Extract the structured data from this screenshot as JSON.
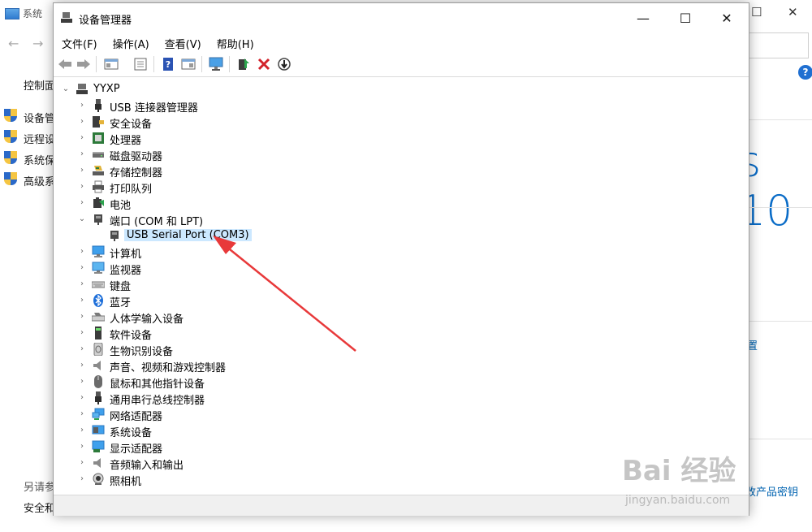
{
  "background_window": {
    "title": "系统",
    "breadcrumb_partial": "控制面",
    "sidebar_links": [
      "设备管",
      "远程设",
      "系统保",
      "高级系"
    ],
    "big_text": "s 10",
    "right_link_1": "置",
    "see_also": "另请参",
    "security": "安全和",
    "product_key_link": "更改产品密钥"
  },
  "device_manager": {
    "title": "设备管理器",
    "window_buttons": {
      "minimize": "—",
      "maximize": "☐",
      "close": "✕"
    },
    "menu": [
      "文件(F)",
      "操作(A)",
      "查看(V)",
      "帮助(H)"
    ],
    "toolbar": [
      "back",
      "forward",
      "properties",
      "show-hidden",
      "help",
      "view-resources",
      "scan-hardware",
      "update-driver",
      "uninstall",
      "disable"
    ],
    "root": "YYXP",
    "categories": [
      {
        "label": "USB 连接器管理器",
        "icon": "usb-icon",
        "expanded": false
      },
      {
        "label": "安全设备",
        "icon": "security-device-icon",
        "expanded": false
      },
      {
        "label": "处理器",
        "icon": "processor-icon",
        "expanded": false
      },
      {
        "label": "磁盘驱动器",
        "icon": "disk-drive-icon",
        "expanded": false
      },
      {
        "label": "存储控制器",
        "icon": "storage-controller-icon",
        "expanded": false
      },
      {
        "label": "打印队列",
        "icon": "printer-icon",
        "expanded": false
      },
      {
        "label": "电池",
        "icon": "battery-icon",
        "expanded": false
      },
      {
        "label": "端口 (COM 和 LPT)",
        "icon": "port-icon",
        "expanded": true,
        "children": [
          {
            "label": "USB Serial Port (COM3)",
            "icon": "serial-port-icon",
            "selected": true
          }
        ]
      },
      {
        "label": "计算机",
        "icon": "computer-icon",
        "expanded": false
      },
      {
        "label": "监视器",
        "icon": "monitor-icon",
        "expanded": false
      },
      {
        "label": "键盘",
        "icon": "keyboard-icon",
        "expanded": false
      },
      {
        "label": "蓝牙",
        "icon": "bluetooth-icon",
        "expanded": false
      },
      {
        "label": "人体学输入设备",
        "icon": "hid-icon",
        "expanded": false
      },
      {
        "label": "软件设备",
        "icon": "software-device-icon",
        "expanded": false
      },
      {
        "label": "生物识别设备",
        "icon": "biometric-icon",
        "expanded": false
      },
      {
        "label": "声音、视频和游戏控制器",
        "icon": "sound-icon",
        "expanded": false
      },
      {
        "label": "鼠标和其他指针设备",
        "icon": "mouse-icon",
        "expanded": false
      },
      {
        "label": "通用串行总线控制器",
        "icon": "usb-controller-icon",
        "expanded": false
      },
      {
        "label": "网络适配器",
        "icon": "network-adapter-icon",
        "expanded": false
      },
      {
        "label": "系统设备",
        "icon": "system-device-icon",
        "expanded": false
      },
      {
        "label": "显示适配器",
        "icon": "display-adapter-icon",
        "expanded": false
      },
      {
        "label": "音频输入和输出",
        "icon": "audio-io-icon",
        "expanded": false
      },
      {
        "label": "照相机",
        "icon": "camera-icon",
        "expanded": false
      }
    ]
  },
  "annotation": {
    "arrow_color": "#e8393a"
  },
  "watermark": {
    "main": "Bai 经验",
    "sub": "jingyan.baidu.com"
  },
  "colors": {
    "selection": "#cce8ff",
    "accent": "#0a6cc7",
    "link": "#0063b1"
  }
}
